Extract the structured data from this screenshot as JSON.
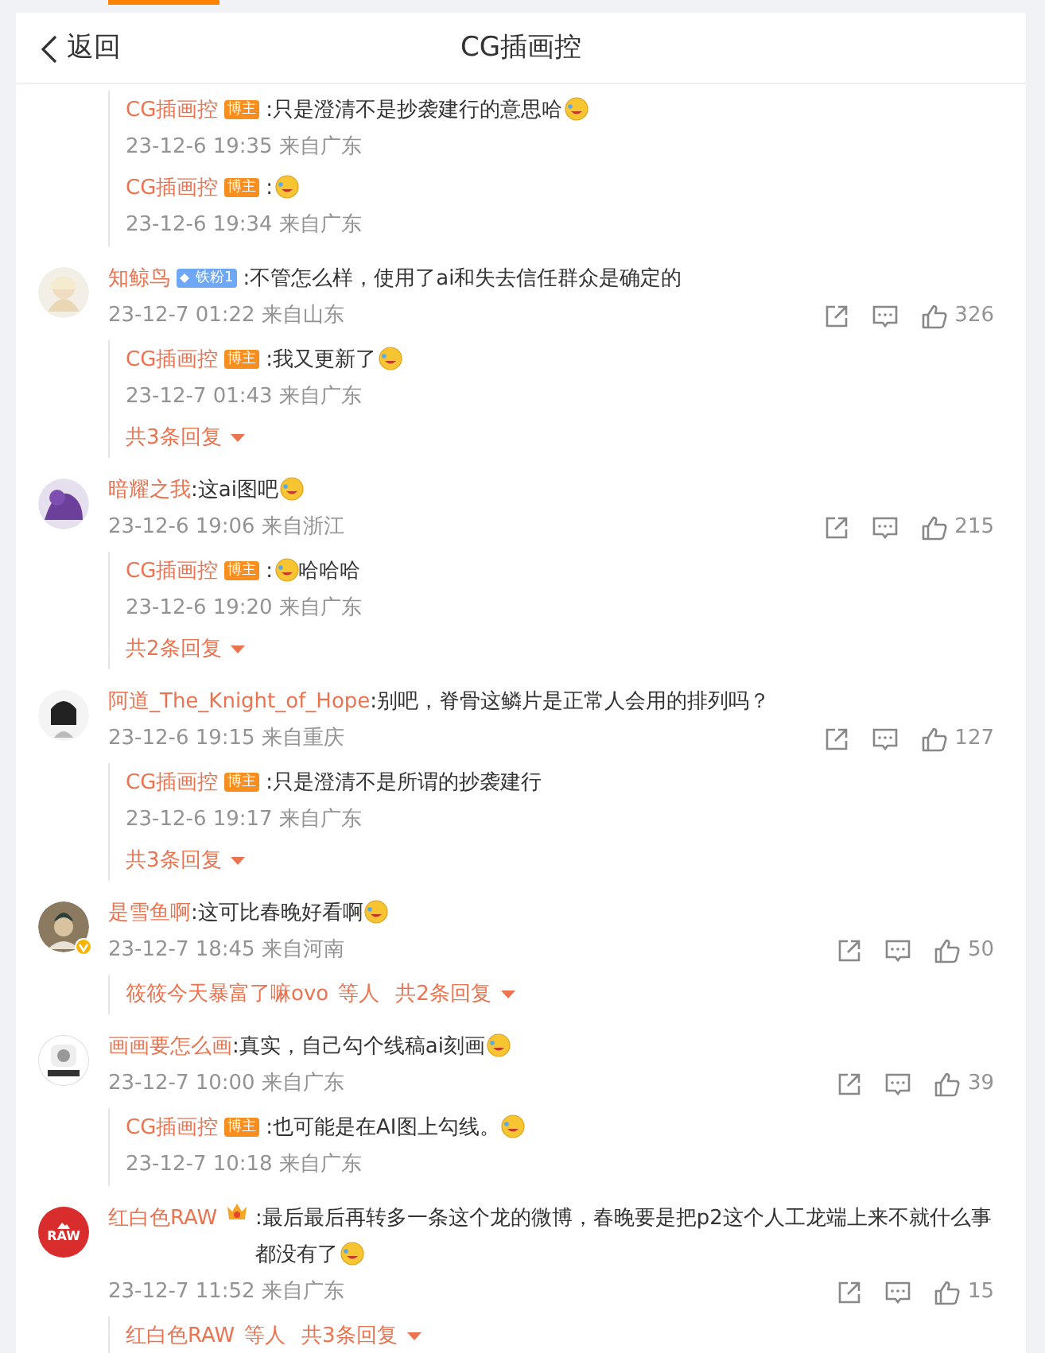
{
  "header": {
    "back": "返回",
    "title": "CG插画控"
  },
  "comments": [
    {
      "replies": [
        {
          "name": "CG插画控",
          "badge": {
            "kind": "host",
            "label": "博主"
          },
          "text": ":只是澄清不是抄袭建行的意思哈",
          "emoji": true,
          "time": "23-12-6 19:35 来自广东"
        },
        {
          "name": "CG插画控",
          "badge": {
            "kind": "host",
            "label": "博主"
          },
          "text": ":",
          "emoji": true,
          "time": "23-12-6 19:34 来自广东"
        }
      ]
    },
    {
      "name": "知鲸鸟",
      "avatar": {
        "kind": "picture"
      },
      "badge": {
        "kind": "fan",
        "label": "铁粉1"
      },
      "text": ":不管怎么样，使用了ai和失去信任群众是确定的",
      "time": "23-12-7 01:22 来自山东",
      "likes": "326",
      "replies": [
        {
          "name": "CG插画控",
          "badge": {
            "kind": "host",
            "label": "博主"
          },
          "text": ":我又更新了",
          "emoji": true,
          "time": "23-12-7 01:43 来自广东"
        }
      ],
      "more": {
        "label": "共3条回复"
      }
    },
    {
      "name": "暗耀之我",
      "avatar": {
        "kind": "picture"
      },
      "text": ":这ai图吧",
      "emoji": true,
      "time": "23-12-6 19:06 来自浙江",
      "likes": "215",
      "replies": [
        {
          "name": "CG插画控",
          "badge": {
            "kind": "host",
            "label": "博主"
          },
          "text": ":",
          "emoji": true,
          "text_after": "哈哈哈",
          "time": "23-12-6 19:20 来自广东"
        }
      ],
      "more": {
        "label": "共2条回复"
      }
    },
    {
      "name": "阿道_The_Knight_of_Hope",
      "avatar": {
        "kind": "picture"
      },
      "text": ":别吧，脊骨这鳞片是正常人会用的排列吗？",
      "time": "23-12-6 19:15 来自重庆",
      "likes": "127",
      "replies": [
        {
          "name": "CG插画控",
          "badge": {
            "kind": "host",
            "label": "博主"
          },
          "text": ":只是澄清不是所谓的抄袭建行",
          "time": "23-12-6 19:17 来自广东"
        }
      ],
      "more": {
        "label": "共3条回复"
      }
    },
    {
      "name": "是雪鱼啊",
      "avatar": {
        "kind": "picture",
        "verified": true
      },
      "text": ":这可比春晚好看啊",
      "emoji": true,
      "time": "23-12-7 18:45 来自河南",
      "likes": "50",
      "more": {
        "who": "筱筱今天暴富了嘛ovo",
        "who_suffix": "等人",
        "label": "共2条回复"
      }
    },
    {
      "name": "画画要怎么画",
      "avatar": {
        "kind": "picture"
      },
      "text": ":真实，自己勾个线稿ai刻画",
      "emoji": true,
      "time": "23-12-7 10:00 来自广东",
      "likes": "39",
      "replies": [
        {
          "name": "CG插画控",
          "badge": {
            "kind": "host",
            "label": "博主"
          },
          "text": ":也可能是在AI图上勾线。",
          "emoji": true,
          "time": "23-12-7 10:18 来自广东"
        }
      ]
    },
    {
      "name": "红白色RAW",
      "avatar": {
        "kind": "logo",
        "text": "RAW"
      },
      "badge": {
        "kind": "crown"
      },
      "text": ":最后最后再转多一条这个龙的微博，春晚要是把p2这个人工龙端上来不就什么事都没有了",
      "emoji": true,
      "time": "23-12-7 11:52 来自广东",
      "likes": "15",
      "more": {
        "who": "红白色RAW",
        "who_suffix": "等人",
        "label": "共3条回复"
      }
    }
  ]
}
